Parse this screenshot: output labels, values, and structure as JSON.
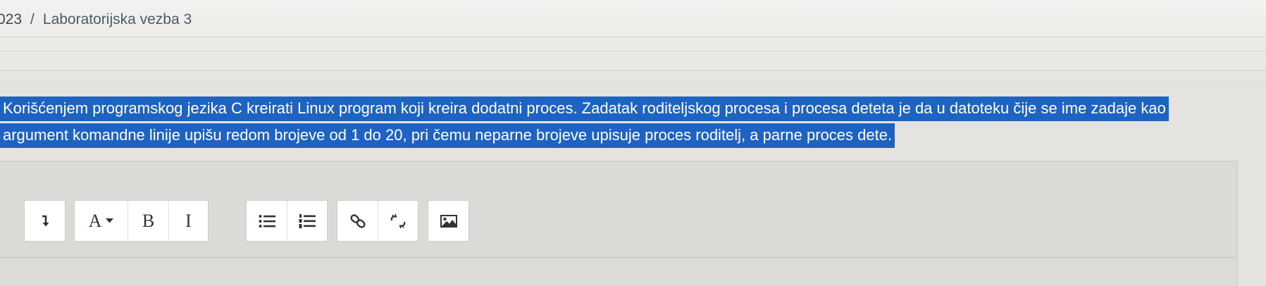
{
  "breadcrumb": {
    "prev": "023",
    "separator": "/",
    "current": "Laboratorijska vezba 3"
  },
  "question": {
    "line1": "Korišćenjem programskog jezika C kreirati Linux program koji kreira dodatni proces. Zadatak roditeljskog procesa i procesa deteta je da u datoteku čije se ime zadaje kao",
    "line2": "argument komandne linije upišu redom brojeve od 1 do 20, pri čemu neparne brojeve upisuje proces roditelj, a parne proces dete."
  },
  "toolbar": {
    "font_label": "A",
    "bold_label": "B",
    "italic_label": "I",
    "icons": [
      "expand-toolbar-icon",
      "font-color-icon",
      "bold-icon",
      "italic-icon",
      "unordered-list-icon",
      "ordered-list-icon",
      "link-icon",
      "unlink-icon",
      "image-icon"
    ]
  },
  "colors": {
    "selection": "#1f63c2",
    "background": "#e4e3e0"
  }
}
